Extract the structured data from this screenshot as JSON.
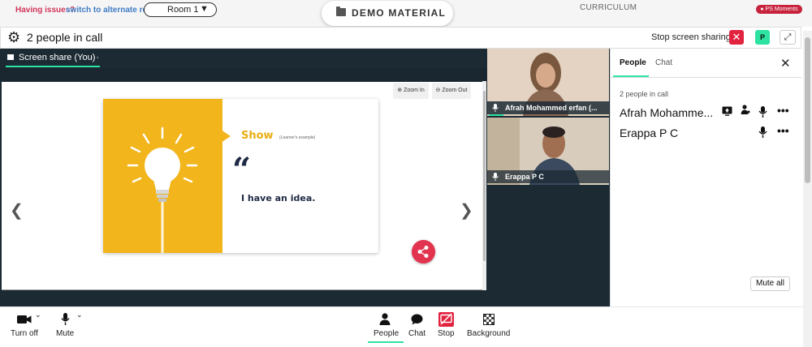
{
  "topbar": {
    "issues_text": "Having issues?",
    "alt_room_link": "switch to alternate room",
    "room_select_value": "Room 1",
    "demo_material_label": "DEMO MATERIAL",
    "curriculum_label": "CURRICULUM",
    "ps_moments_label": "PS Moments"
  },
  "call_header": {
    "title": "2 people in call",
    "stop_sharing_label": "Stop screen sharing",
    "user_badge": "P"
  },
  "stage": {
    "share_tab_label": "Screen share (You)",
    "share_tab_menu": "···",
    "zoom_in_label": "Zoom In",
    "zoom_out_label": "Zoom Out",
    "slide": {
      "heading": "Show",
      "subheading": "(Learner's example)",
      "quote_mark": "“",
      "statement": "I have an idea."
    }
  },
  "videos": [
    {
      "name": "Afrah Mohammed erfan (..."
    },
    {
      "name": "Erappa P C"
    }
  ],
  "panel": {
    "tabs": [
      {
        "label": "People"
      },
      {
        "label": "Chat"
      }
    ],
    "count_text": "2 people in call",
    "participants": [
      {
        "name": "Afrah Mohamme..."
      },
      {
        "name": "Erappa P C"
      }
    ],
    "mute_all_label": "Mute all"
  },
  "controls": {
    "camera_label": "Turn off",
    "mic_label": "Mute",
    "people_label": "People",
    "chat_label": "Chat",
    "stop_label": "Stop",
    "background_label": "Background"
  }
}
